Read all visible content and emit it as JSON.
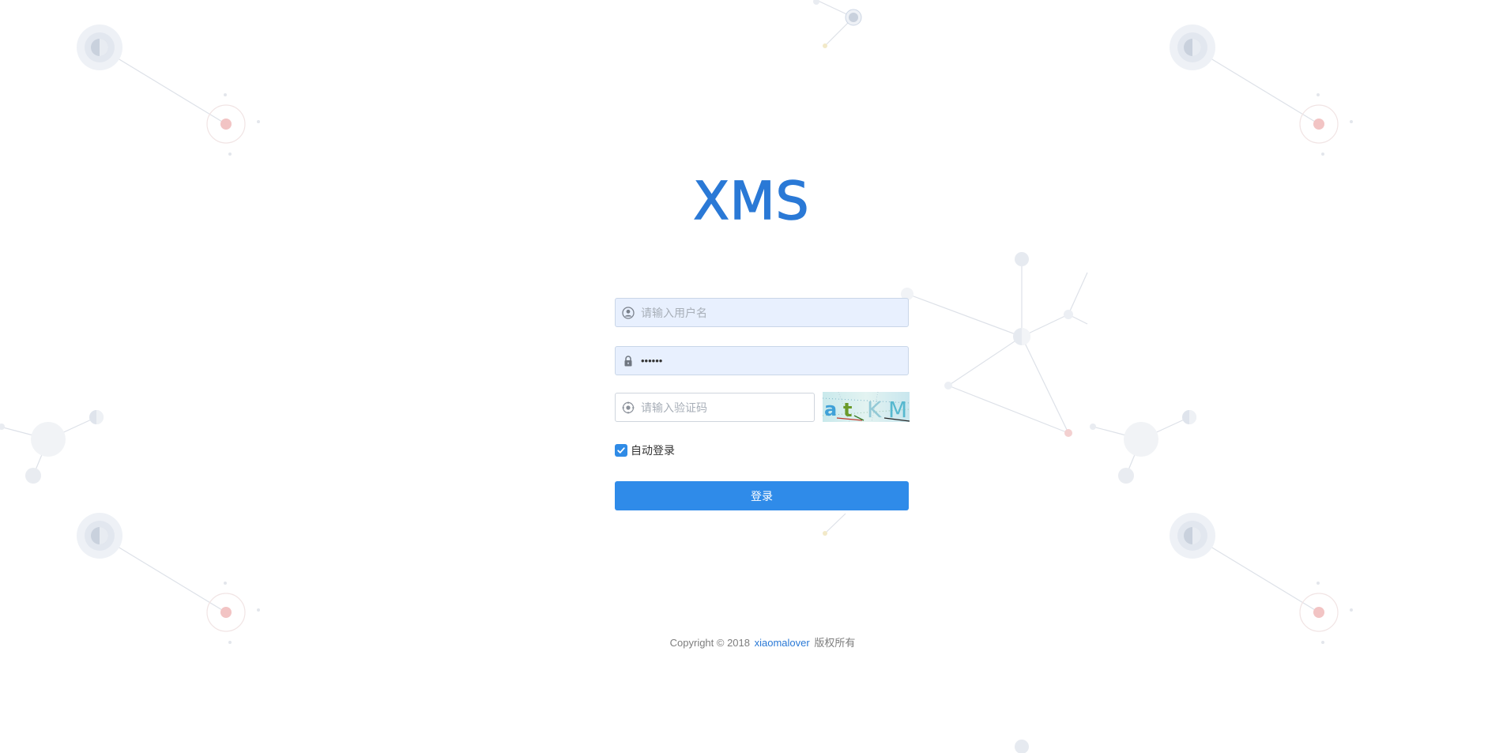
{
  "app": {
    "logo_text": "XMS"
  },
  "form": {
    "username": {
      "placeholder": "请输入用户名",
      "value": "",
      "icon": "user-icon"
    },
    "password": {
      "value": "••••••",
      "icon": "lock-icon"
    },
    "captcha": {
      "placeholder": "请输入验证码",
      "value": "",
      "icon": "target-icon",
      "image_text": "atKM"
    },
    "remember": {
      "label": "自动登录",
      "checked": true
    },
    "submit_label": "登录"
  },
  "footer": {
    "prefix": "Copyright © 2018",
    "link_text": "xiaomalover",
    "suffix": "版权所有"
  },
  "colors": {
    "brand": "#2a79d6",
    "button": "#2f8be9",
    "input_autofill": "#e8f0fe"
  }
}
